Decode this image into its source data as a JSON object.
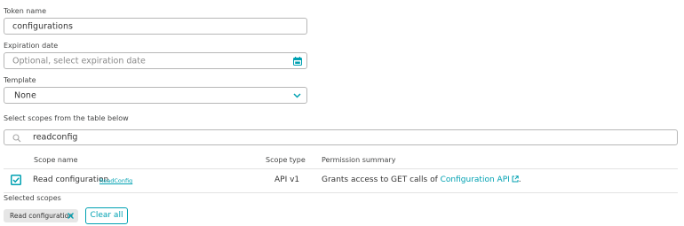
{
  "form": {
    "token_name": {
      "label": "Token name",
      "value": "configurations"
    },
    "expiration": {
      "label": "Expiration date",
      "placeholder": "Optional, select expiration date"
    },
    "template": {
      "label": "Template",
      "selected": "None"
    },
    "scopes_prompt": "Select scopes from the table below",
    "search": {
      "value": "readconfig"
    }
  },
  "table": {
    "headers": {
      "name": "Scope name",
      "type": "Scope type",
      "summary": "Permission summary"
    },
    "rows": [
      {
        "checked": true,
        "name": "Read configuration",
        "tag": "ReadConfig",
        "type": "API v1",
        "summary_prefix": "Grants access to GET calls of",
        "summary_link": "Configuration API",
        "summary_suffix": "."
      }
    ]
  },
  "selected": {
    "label": "Selected scopes",
    "chips": [
      {
        "label": "Read configuration"
      }
    ],
    "clear_label": "Clear all"
  },
  "colors": {
    "accent": "#00a1b2",
    "border": "#b7b7b7",
    "chip_bg": "#e6e6e6"
  },
  "icons": {
    "calendar": "calendar-icon",
    "dropdown": "chevron-down-icon",
    "search": "search-icon",
    "checkbox": "checkbox-checked-icon",
    "external": "external-link-icon",
    "remove": "close-icon"
  }
}
